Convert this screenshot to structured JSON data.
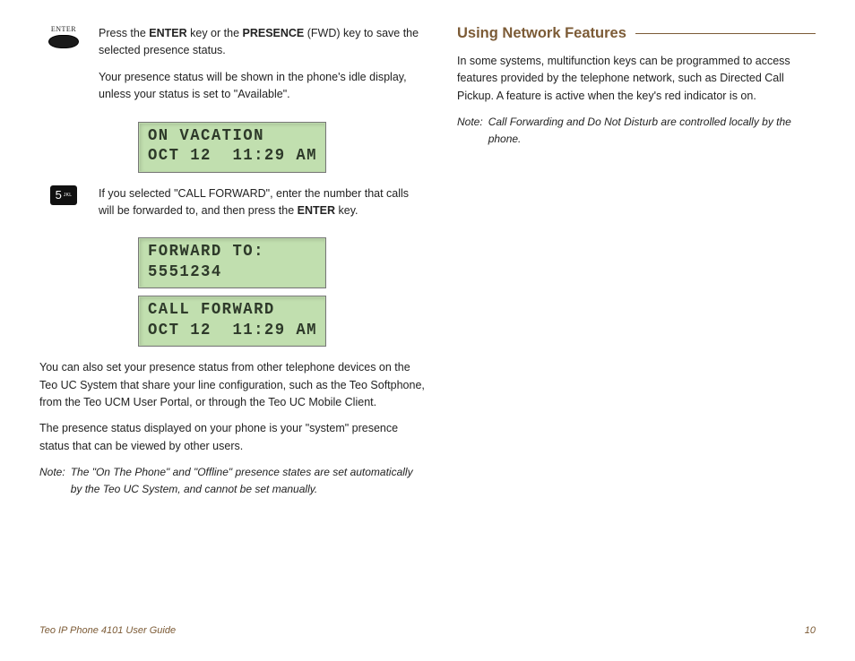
{
  "left": {
    "enter_key_label": "ENTER",
    "p1_pre": "Press the ",
    "p1_k1": "ENTER",
    "p1_mid": " key or the ",
    "p1_k2": "PRESENCE",
    "p1_post": " (FWD) key to save the selected presence status.",
    "p2": "Your presence status will be shown in the phone's idle display, unless your status is set to \"Available\".",
    "lcd1_l1": "ON VACATION",
    "lcd1_l2": "OCT 12  11:29 AM",
    "key5_digit": "5",
    "key5_letters": "JKL",
    "p3_pre": "If you selected \"CALL FORWARD\", enter the number that calls will be forwarded to, and then press the ",
    "p3_k1": "ENTER",
    "p3_post": " key.",
    "lcd2_l1": "FORWARD TO:",
    "lcd2_l2": "5551234",
    "lcd3_l1": "CALL FORWARD",
    "lcd3_l2": "OCT 12  11:29 AM",
    "p4": "You can also set your presence status from other telephone devices on the Teo UC System that share your line configuration, such as the Teo Softphone, from the Teo UCM User Portal, or through the Teo UC Mobile Client.",
    "p5": "The presence status displayed on your phone is your \"system\" presence status that can be viewed by other users.",
    "note_label": "Note:",
    "note_body": "The \"On The Phone\" and \"Offline\" presence states are set automatically by the Teo UC System, and cannot be set manually."
  },
  "right": {
    "heading": "Using Network Features",
    "p1": "In some systems, multifunction keys can be programmed to access features provided by the telephone network, such as Directed Call Pickup. A feature is active when the key's red indicator is on.",
    "note_label": "Note:",
    "note_body": "Call Forwarding and Do Not Disturb are controlled locally by the phone."
  },
  "footer": {
    "title": "Teo IP Phone 4101 User Guide",
    "page": "10"
  }
}
